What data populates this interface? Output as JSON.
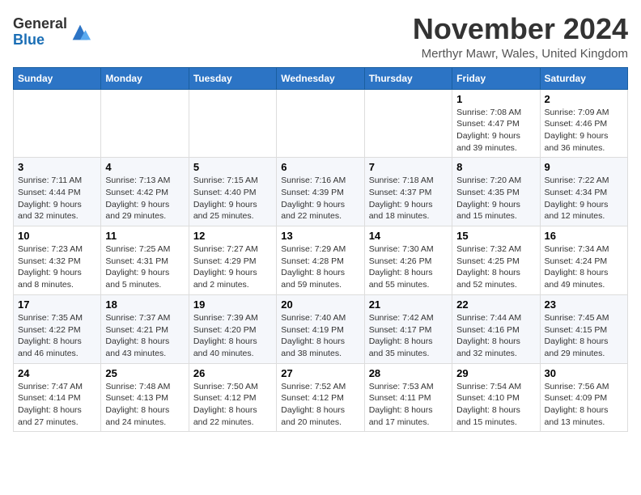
{
  "logo": {
    "general": "General",
    "blue": "Blue"
  },
  "title": "November 2024",
  "location": "Merthyr Mawr, Wales, United Kingdom",
  "weekdays": [
    "Sunday",
    "Monday",
    "Tuesday",
    "Wednesday",
    "Thursday",
    "Friday",
    "Saturday"
  ],
  "weeks": [
    [
      {
        "day": "",
        "info": ""
      },
      {
        "day": "",
        "info": ""
      },
      {
        "day": "",
        "info": ""
      },
      {
        "day": "",
        "info": ""
      },
      {
        "day": "",
        "info": ""
      },
      {
        "day": "1",
        "info": "Sunrise: 7:08 AM\nSunset: 4:47 PM\nDaylight: 9 hours and 39 minutes."
      },
      {
        "day": "2",
        "info": "Sunrise: 7:09 AM\nSunset: 4:46 PM\nDaylight: 9 hours and 36 minutes."
      }
    ],
    [
      {
        "day": "3",
        "info": "Sunrise: 7:11 AM\nSunset: 4:44 PM\nDaylight: 9 hours and 32 minutes."
      },
      {
        "day": "4",
        "info": "Sunrise: 7:13 AM\nSunset: 4:42 PM\nDaylight: 9 hours and 29 minutes."
      },
      {
        "day": "5",
        "info": "Sunrise: 7:15 AM\nSunset: 4:40 PM\nDaylight: 9 hours and 25 minutes."
      },
      {
        "day": "6",
        "info": "Sunrise: 7:16 AM\nSunset: 4:39 PM\nDaylight: 9 hours and 22 minutes."
      },
      {
        "day": "7",
        "info": "Sunrise: 7:18 AM\nSunset: 4:37 PM\nDaylight: 9 hours and 18 minutes."
      },
      {
        "day": "8",
        "info": "Sunrise: 7:20 AM\nSunset: 4:35 PM\nDaylight: 9 hours and 15 minutes."
      },
      {
        "day": "9",
        "info": "Sunrise: 7:22 AM\nSunset: 4:34 PM\nDaylight: 9 hours and 12 minutes."
      }
    ],
    [
      {
        "day": "10",
        "info": "Sunrise: 7:23 AM\nSunset: 4:32 PM\nDaylight: 9 hours and 8 minutes."
      },
      {
        "day": "11",
        "info": "Sunrise: 7:25 AM\nSunset: 4:31 PM\nDaylight: 9 hours and 5 minutes."
      },
      {
        "day": "12",
        "info": "Sunrise: 7:27 AM\nSunset: 4:29 PM\nDaylight: 9 hours and 2 minutes."
      },
      {
        "day": "13",
        "info": "Sunrise: 7:29 AM\nSunset: 4:28 PM\nDaylight: 8 hours and 59 minutes."
      },
      {
        "day": "14",
        "info": "Sunrise: 7:30 AM\nSunset: 4:26 PM\nDaylight: 8 hours and 55 minutes."
      },
      {
        "day": "15",
        "info": "Sunrise: 7:32 AM\nSunset: 4:25 PM\nDaylight: 8 hours and 52 minutes."
      },
      {
        "day": "16",
        "info": "Sunrise: 7:34 AM\nSunset: 4:24 PM\nDaylight: 8 hours and 49 minutes."
      }
    ],
    [
      {
        "day": "17",
        "info": "Sunrise: 7:35 AM\nSunset: 4:22 PM\nDaylight: 8 hours and 46 minutes."
      },
      {
        "day": "18",
        "info": "Sunrise: 7:37 AM\nSunset: 4:21 PM\nDaylight: 8 hours and 43 minutes."
      },
      {
        "day": "19",
        "info": "Sunrise: 7:39 AM\nSunset: 4:20 PM\nDaylight: 8 hours and 40 minutes."
      },
      {
        "day": "20",
        "info": "Sunrise: 7:40 AM\nSunset: 4:19 PM\nDaylight: 8 hours and 38 minutes."
      },
      {
        "day": "21",
        "info": "Sunrise: 7:42 AM\nSunset: 4:17 PM\nDaylight: 8 hours and 35 minutes."
      },
      {
        "day": "22",
        "info": "Sunrise: 7:44 AM\nSunset: 4:16 PM\nDaylight: 8 hours and 32 minutes."
      },
      {
        "day": "23",
        "info": "Sunrise: 7:45 AM\nSunset: 4:15 PM\nDaylight: 8 hours and 29 minutes."
      }
    ],
    [
      {
        "day": "24",
        "info": "Sunrise: 7:47 AM\nSunset: 4:14 PM\nDaylight: 8 hours and 27 minutes."
      },
      {
        "day": "25",
        "info": "Sunrise: 7:48 AM\nSunset: 4:13 PM\nDaylight: 8 hours and 24 minutes."
      },
      {
        "day": "26",
        "info": "Sunrise: 7:50 AM\nSunset: 4:12 PM\nDaylight: 8 hours and 22 minutes."
      },
      {
        "day": "27",
        "info": "Sunrise: 7:52 AM\nSunset: 4:12 PM\nDaylight: 8 hours and 20 minutes."
      },
      {
        "day": "28",
        "info": "Sunrise: 7:53 AM\nSunset: 4:11 PM\nDaylight: 8 hours and 17 minutes."
      },
      {
        "day": "29",
        "info": "Sunrise: 7:54 AM\nSunset: 4:10 PM\nDaylight: 8 hours and 15 minutes."
      },
      {
        "day": "30",
        "info": "Sunrise: 7:56 AM\nSunset: 4:09 PM\nDaylight: 8 hours and 13 minutes."
      }
    ]
  ]
}
